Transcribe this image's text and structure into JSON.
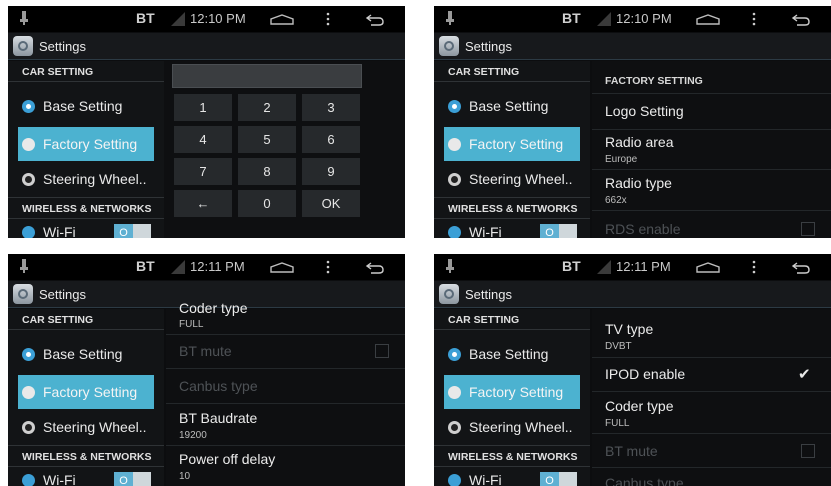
{
  "status": {
    "bt": "BT",
    "times": [
      "12:10 PM",
      "12:10 PM",
      "12:11 PM",
      "12:11 PM"
    ]
  },
  "app": {
    "title": "Settings"
  },
  "sidebar": {
    "car_header": "CAR SETTING",
    "items": [
      {
        "label": "Base Setting",
        "icon": "gear-icon"
      },
      {
        "label": "Factory Setting",
        "icon": "factory-icon"
      },
      {
        "label": "Steering Wheel..",
        "icon": "steering-wheel-icon"
      }
    ],
    "wireless_header": "WIRELESS & NETWORKS",
    "wifi_label": "Wi-Fi",
    "wifi_toggle": "O"
  },
  "keypad": {
    "keys": [
      "1",
      "2",
      "3",
      "4",
      "5",
      "6",
      "7",
      "8",
      "9",
      "←",
      "0",
      "OK"
    ]
  },
  "panel2": {
    "header": "FACTORY SETTING",
    "logo_setting": "Logo Setting",
    "radio_area": "Radio area",
    "radio_area_value": "Europe",
    "radio_type": "Radio type",
    "radio_type_value": "662x",
    "rds_enable": "RDS enable"
  },
  "panel3": {
    "coder_type": "Coder type",
    "coder_type_value": "FULL",
    "bt_mute": "BT mute",
    "canbus_type": "Canbus type",
    "bt_baudrate": "BT Baudrate",
    "bt_baudrate_value": "19200",
    "power_off_delay": "Power off delay",
    "power_off_delay_value": "10"
  },
  "panel4": {
    "tv_type": "TV type",
    "tv_type_value": "DVBT",
    "ipod_enable": "IPOD enable",
    "ipod_checked": "✔",
    "coder_type": "Coder type",
    "coder_type_value": "FULL",
    "bt_mute": "BT mute",
    "canbus_type": "Canbus type"
  },
  "colors": {
    "accent": "#4cb2d0",
    "background": "#0c0d0f"
  }
}
